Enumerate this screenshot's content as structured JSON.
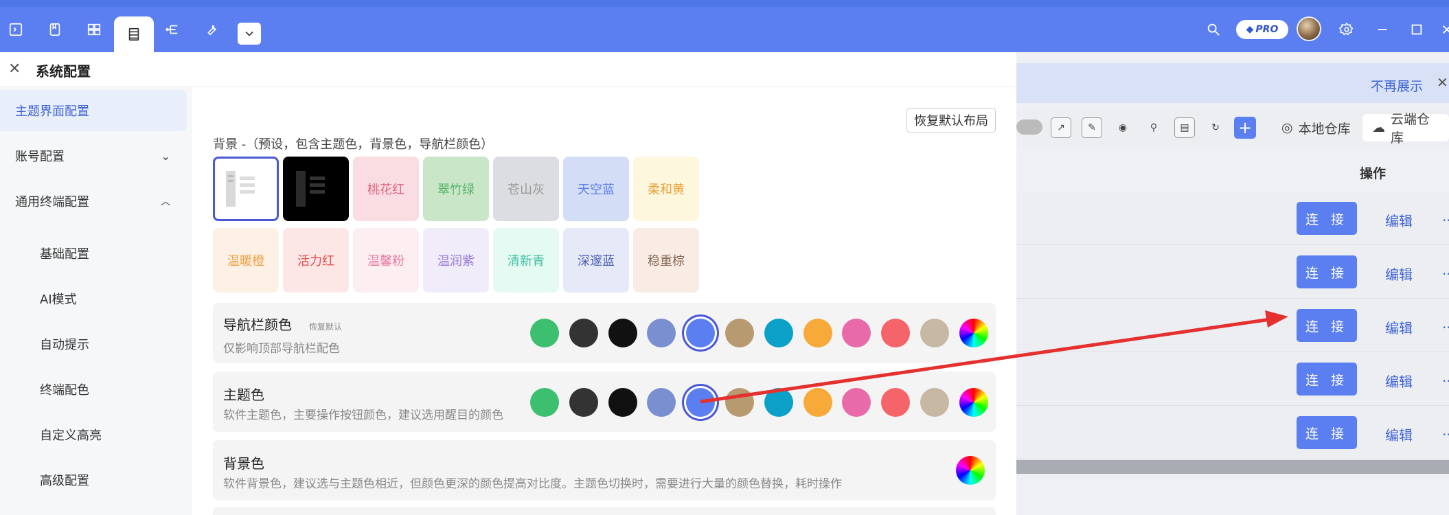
{
  "nav": {
    "tabs": [
      {
        "icon": "terminal-icon"
      },
      {
        "icon": "file-icon"
      },
      {
        "icon": "layout-icon"
      },
      {
        "icon": "list-icon"
      },
      {
        "icon": "tree-icon"
      },
      {
        "icon": "wrench-icon"
      }
    ],
    "active_tab_icon": "list-icon",
    "pro_label": "PRO",
    "accent": "#5b7ff0"
  },
  "banner": {
    "text": "不再展示"
  },
  "toolbar": {
    "local_repo": "本地仓库",
    "cloud_repo": "云端仓库"
  },
  "table": {
    "op_header": "操作",
    "rows": [
      {
        "connect": "连 接",
        "edit": "编辑",
        "more": "..."
      },
      {
        "connect": "连 接",
        "edit": "编辑",
        "more": "..."
      },
      {
        "connect": "连 接",
        "edit": "编辑",
        "more": "..."
      },
      {
        "connect": "连 接",
        "edit": "编辑",
        "more": "..."
      },
      {
        "connect": "连 接",
        "edit": "编辑",
        "more": "..."
      }
    ]
  },
  "modal": {
    "title": "系统配置",
    "sidebar": {
      "items": [
        {
          "label": "主题界面配置"
        },
        {
          "label": "账号配置"
        },
        {
          "label": "通用终端配置"
        }
      ],
      "subitems": [
        "基础配置",
        "AI模式",
        "自动提示",
        "终端配色",
        "自定义高亮",
        "高级配置"
      ]
    },
    "restore_layout": "恢复默认布局",
    "bg_label": "背景 -（预设，包含主题色，背景色，导航栏颜色）",
    "presets_row1": [
      {
        "label": "",
        "bg": "#ffffff",
        "fg": "#888888"
      },
      {
        "label": "",
        "bg": "#000000",
        "fg": "#555555"
      },
      {
        "label": "桃花红",
        "bg": "#f9dde3",
        "fg": "#e0637e"
      },
      {
        "label": "翠竹绿",
        "bg": "#c9e6c9",
        "fg": "#58b36a"
      },
      {
        "label": "苍山灰",
        "bg": "#dcdde1",
        "fg": "#999999"
      },
      {
        "label": "天空蓝",
        "bg": "#d3ddf6",
        "fg": "#5b7ff0"
      },
      {
        "label": "柔和黄",
        "bg": "#fdf7dd",
        "fg": "#e6a23c"
      }
    ],
    "presets_row2": [
      {
        "label": "温暖橙",
        "bg": "#fdf1e6",
        "fg": "#f0a040"
      },
      {
        "label": "活力红",
        "bg": "#fde6e6",
        "fg": "#e05050"
      },
      {
        "label": "温馨粉",
        "bg": "#fdeef2",
        "fg": "#e879a0"
      },
      {
        "label": "温润紫",
        "bg": "#f0ecfa",
        "fg": "#9a7bd4"
      },
      {
        "label": "清新青",
        "bg": "#e6faf4",
        "fg": "#3cbfa0"
      },
      {
        "label": "深邃蓝",
        "bg": "#e6e9f7",
        "fg": "#4a5fb8"
      },
      {
        "label": "稳重棕",
        "bg": "#f8ece4",
        "fg": "#8a6a58"
      }
    ],
    "nav_color": {
      "title": "导航栏颜色",
      "restore": "恢复默认",
      "subtitle": "仅影响顶部导航栏配色",
      "colors": [
        "#3cbf6e",
        "#333333",
        "#111111",
        "#7a8fd0",
        "#5b7ff0",
        "#b89a70",
        "#0aa0c8",
        "#f7a93a",
        "#e96aa8",
        "#f56468",
        "#c7b8a4",
        "rainbow"
      ],
      "selected_index": 4
    },
    "theme_color": {
      "title": "主题色",
      "subtitle": "软件主题色，主要操作按钮颜色，建议选用醒目的颜色",
      "colors": [
        "#3cbf6e",
        "#333333",
        "#111111",
        "#7a8fd0",
        "#5b7ff0",
        "#b89a70",
        "#0aa0c8",
        "#f7a93a",
        "#e96aa8",
        "#f56468",
        "#c7b8a4",
        "rainbow"
      ],
      "selected_index": 4
    },
    "bg_color": {
      "title": "背景色",
      "subtitle": "软件背景色，建议选与主题色相近，但颜色更深的颜色提高对比度。主题色切换时，需要进行大量的颜色替换，耗时操作"
    }
  }
}
